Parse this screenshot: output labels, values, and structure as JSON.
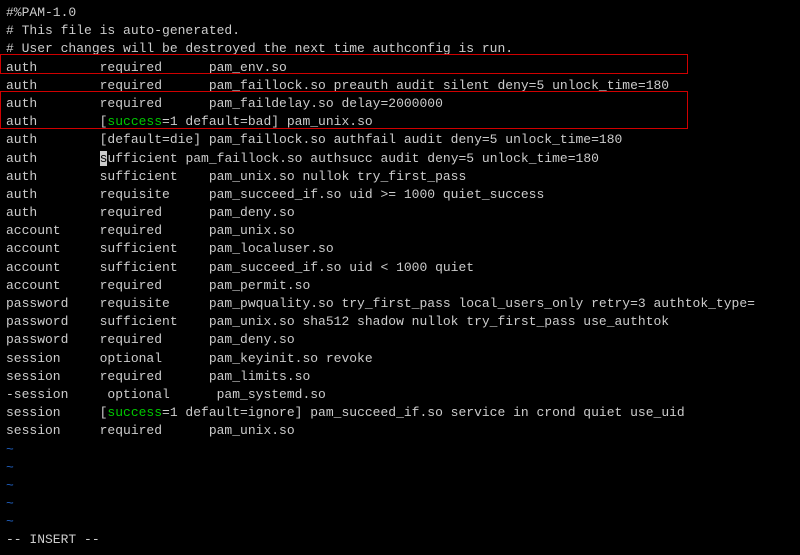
{
  "header": {
    "l1": "#%PAM-1.0",
    "l2": "# This file is auto-generated.",
    "l3": "# User changes will be destroyed the next time authconfig is run."
  },
  "auth": {
    "r1": "auth        required      pam_env.so",
    "r2": "auth        required      pam_faillock.so preauth audit silent deny=5 unlock_time=180",
    "r3": "auth        required      pam_faildelay.so delay=2000000",
    "r4a": "auth        [",
    "r4b": "success",
    "r4c": "=1 default=bad] pam_unix.so",
    "r5": "auth        [default=die] pam_faillock.so authfail audit deny=5 unlock_time=180",
    "r6a": "auth        ",
    "r6cursor": "s",
    "r6b": "ufficient pam_faillock.so authsucc audit deny=5 unlock_time=180",
    "r7": "auth        sufficient    pam_unix.so nullok try_first_pass",
    "r8": "auth        requisite     pam_succeed_if.so uid >= 1000 quiet_success",
    "r9": "auth        required      pam_deny.so"
  },
  "account": {
    "r1": "account     required      pam_unix.so",
    "r2": "account     sufficient    pam_localuser.so",
    "r3": "account     sufficient    pam_succeed_if.so uid < 1000 quiet",
    "r4": "account     required      pam_permit.so"
  },
  "password": {
    "r1": "password    requisite     pam_pwquality.so try_first_pass local_users_only retry=3 authtok_type=",
    "r2": "password    sufficient    pam_unix.so sha512 shadow nullok try_first_pass use_authtok",
    "r3": "password    required      pam_deny.so"
  },
  "session": {
    "r1": "session     optional      pam_keyinit.so revoke",
    "r2": "session     required      pam_limits.so",
    "r3": "-session     optional      pam_systemd.so",
    "r4a": "session     [",
    "r4b": "success",
    "r4c": "=1 default=ignore] pam_succeed_if.so service in crond quiet use_uid",
    "r5": "session     required      pam_unix.so"
  },
  "tilde": "~",
  "blank": "",
  "status": "-- INSERT --"
}
